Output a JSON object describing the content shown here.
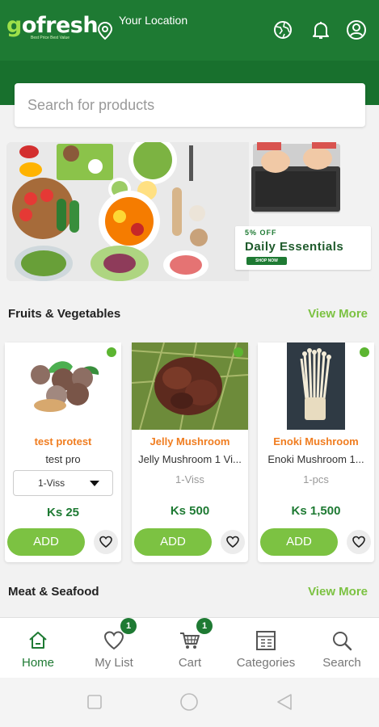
{
  "header": {
    "logo_text": "gofresh",
    "logo_tagline": "Best Price Best Value",
    "location_label": "Your Location",
    "icons": [
      "location-pin-icon",
      "globe-icon",
      "bell-icon",
      "user-circle-icon"
    ]
  },
  "search": {
    "placeholder": "Search for products"
  },
  "banner": {
    "promo_off": "5% OFF",
    "promo_title": "Daily Essentials",
    "promo_button": "SHOP NOW"
  },
  "sections": {
    "fruits": {
      "title": "Fruits & Vegetables",
      "view_more": "View More"
    },
    "meat": {
      "title": "Meat & Seafood",
      "view_more": "View More"
    }
  },
  "products": [
    {
      "name": "test protest",
      "description": "test pro",
      "unit": "1-Viss",
      "price": "Ks 25",
      "add_label": "ADD",
      "has_select": true
    },
    {
      "name": "Jelly Mushroom",
      "description": "Jelly Mushroom 1 Vi...",
      "unit": "1-Viss",
      "price": "Ks 500",
      "add_label": "ADD",
      "has_select": false
    },
    {
      "name": "Enoki Mushroom",
      "description": "Enoki Mushroom 1...",
      "unit": "1-pcs",
      "price": "Ks 1,500",
      "add_label": "ADD",
      "has_select": false
    }
  ],
  "bottom_nav": [
    {
      "label": "Home",
      "icon": "home-icon",
      "active": true,
      "badge": null
    },
    {
      "label": "My List",
      "icon": "heart-icon",
      "active": false,
      "badge": "1"
    },
    {
      "label": "Cart",
      "icon": "cart-icon",
      "active": false,
      "badge": "1"
    },
    {
      "label": "Categories",
      "icon": "categories-icon",
      "active": false,
      "badge": null
    },
    {
      "label": "Search",
      "icon": "search-icon",
      "active": false,
      "badge": null
    }
  ],
  "colors": {
    "header_green": "#1e7a33",
    "accent_green": "#7cc242",
    "product_name_orange": "#f07d20",
    "price_green": "#1e7a33"
  }
}
